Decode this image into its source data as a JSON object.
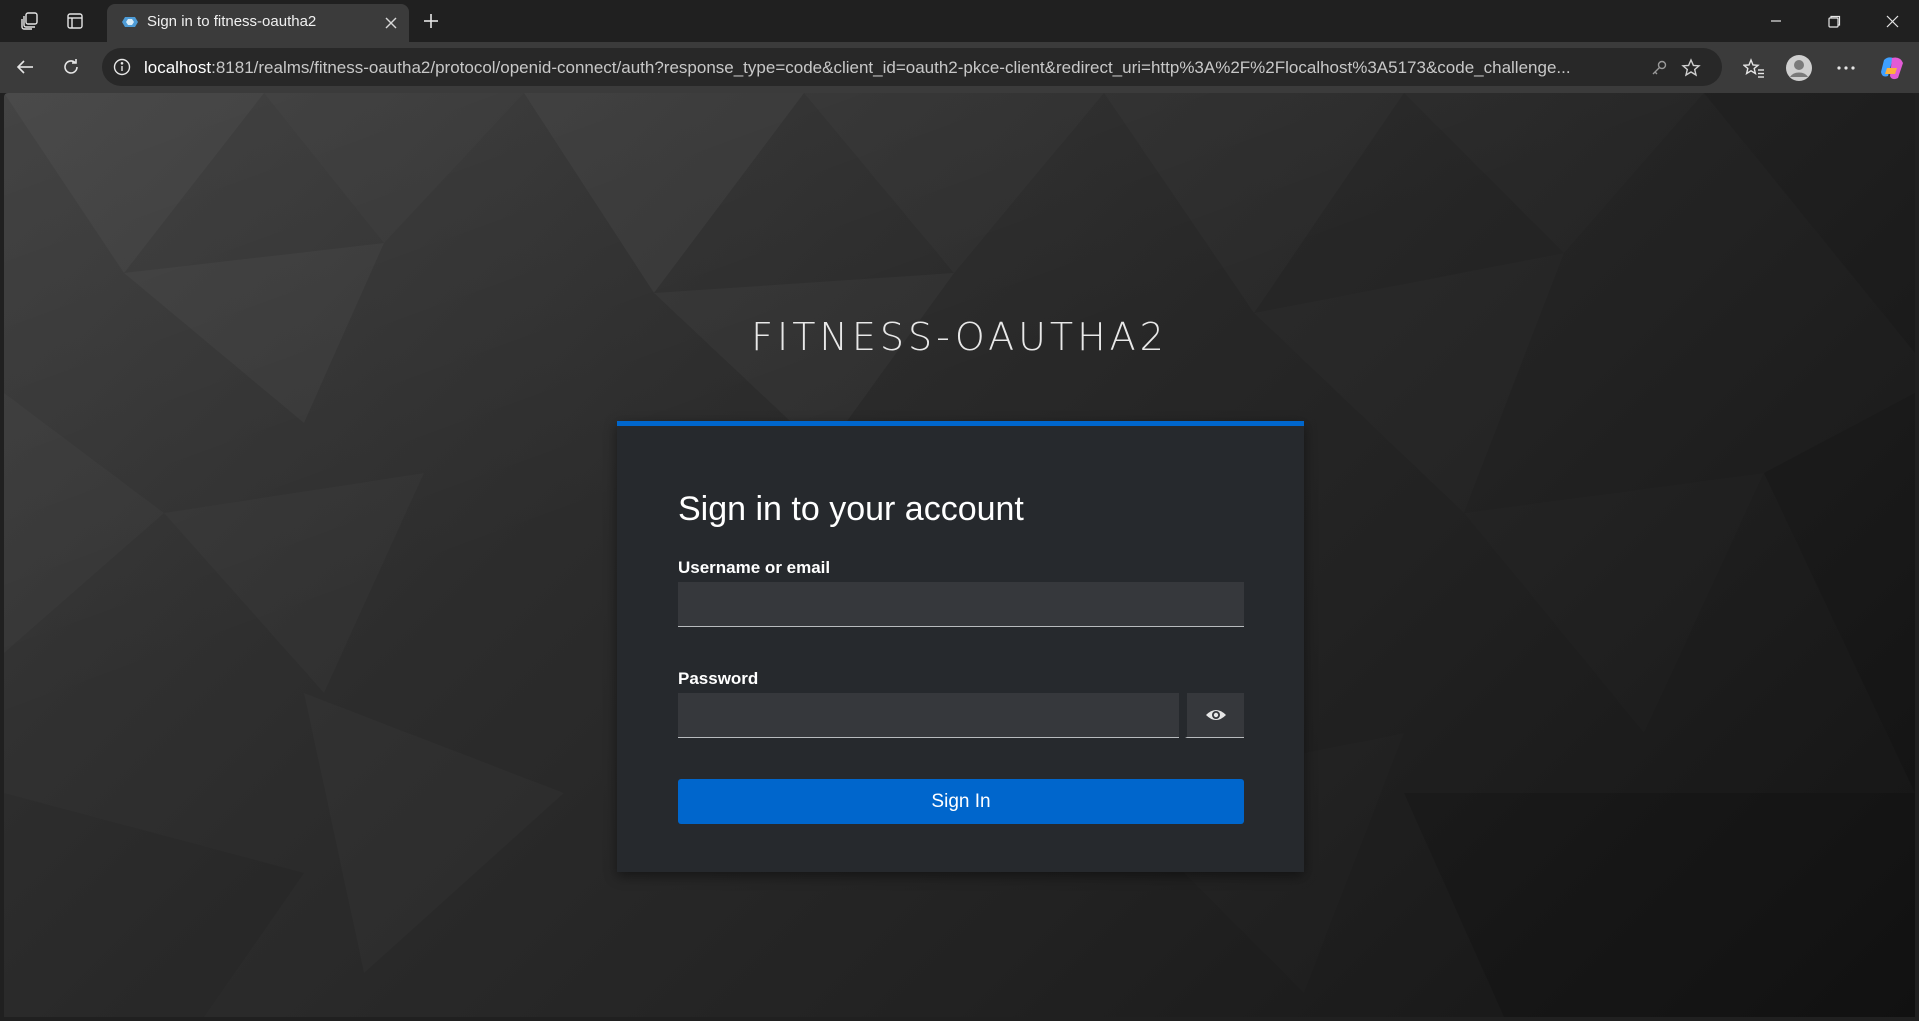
{
  "browser": {
    "tab": {
      "title": "Sign in to fitness-oautha2"
    },
    "address": {
      "host": "localhost",
      "rest": ":8181/realms/fitness-oautha2/protocol/openid-connect/auth?response_type=code&client_id=oauth2-pkce-client&redirect_uri=http%3A%2F%2Flocalhost%3A5173&code_challenge..."
    },
    "icons": {
      "workspaces": "workspaces-icon",
      "vertical_tabs": "vertical-tabs-icon",
      "new_tab": "plus-icon",
      "back": "back-arrow-icon",
      "refresh": "refresh-icon",
      "site_info": "info-icon",
      "key": "key-icon",
      "favorite": "star-icon",
      "favorites": "favorites-icon",
      "profile": "profile-icon",
      "more": "more-icon",
      "copilot": "copilot-icon",
      "minimize": "minimize-icon",
      "restore": "restore-icon",
      "close": "close-icon"
    }
  },
  "login": {
    "realm_title": "FITNESS-OAUTHA2",
    "heading": "Sign in to your account",
    "username_label": "Username or email",
    "username_value": "",
    "password_label": "Password",
    "password_value": "",
    "show_password_icon": "eye-icon",
    "submit_label": "Sign In"
  },
  "colors": {
    "accent": "#0066cc",
    "card_bg": "#26292d",
    "input_bg": "#36383c"
  }
}
